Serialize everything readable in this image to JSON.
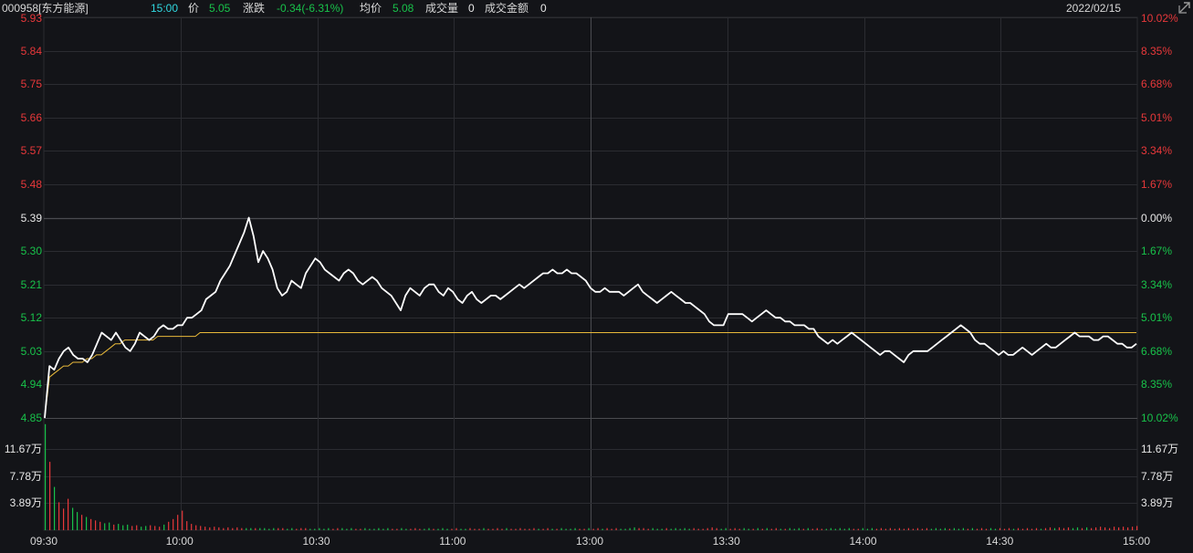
{
  "header": {
    "code_name": "000958[东方能源]",
    "time": "15:00",
    "price_label": "价",
    "price_value": "5.05",
    "change_label": "涨跌",
    "change_value": "-0.34(-6.31%)",
    "avg_label": "均价",
    "avg_value": "5.08",
    "volume_label": "成交量",
    "volume_value": "0",
    "amount_label": "成交金额",
    "amount_value": "0",
    "date": "2022/02/15"
  },
  "icons": {
    "expand": "expand-arrow-icon"
  },
  "colors": {
    "background": "#131418",
    "up": "#e8383a",
    "down": "#18c24a",
    "price_line": "#ffffff",
    "avg_line": "#e8b93a",
    "grid": "#2b2c31",
    "grid_mid": "#4a4b50"
  },
  "price_axis_left": [
    "5.93",
    "5.84",
    "5.75",
    "5.66",
    "5.57",
    "5.48",
    "5.39",
    "5.30",
    "5.21",
    "5.12",
    "5.03",
    "4.94",
    "4.85"
  ],
  "price_axis_right": [
    "10.02%",
    "8.35%",
    "6.68%",
    "5.01%",
    "3.34%",
    "1.67%",
    "0.00%",
    "1.67%",
    "3.34%",
    "5.01%",
    "6.68%",
    "8.35%",
    "10.02%"
  ],
  "volume_axis": [
    "11.67万",
    "7.78万",
    "3.89万"
  ],
  "time_axis": [
    "09:30",
    "10:00",
    "10:30",
    "11:00",
    "13:00",
    "13:30",
    "14:00",
    "14:30",
    "15:00"
  ],
  "chart_data": {
    "type": "line",
    "prev_close": 5.39,
    "ylim": [
      4.85,
      5.93
    ],
    "x_range": [
      "09:30",
      "15:00"
    ],
    "series": [
      {
        "values": [
          4.85,
          4.99,
          4.98,
          5.01,
          5.03,
          5.04,
          5.02,
          5.01,
          5.01,
          5.0,
          5.02,
          5.05,
          5.08,
          5.07,
          5.06,
          5.08,
          5.06,
          5.04,
          5.03,
          5.05,
          5.08,
          5.07,
          5.06,
          5.07,
          5.09,
          5.1,
          5.09,
          5.09,
          5.1,
          5.1,
          5.12,
          5.12,
          5.13,
          5.14,
          5.17,
          5.18,
          5.19,
          5.22,
          5.24,
          5.26,
          5.29,
          5.32,
          5.35,
          5.39,
          5.34,
          5.27,
          5.3,
          5.28,
          5.25,
          5.2,
          5.18,
          5.19,
          5.22,
          5.21,
          5.2,
          5.24,
          5.26,
          5.28,
          5.27,
          5.25,
          5.24,
          5.23,
          5.22,
          5.24,
          5.25,
          5.24,
          5.22,
          5.21,
          5.22,
          5.23,
          5.22,
          5.2,
          5.19,
          5.18,
          5.16,
          5.14,
          5.18,
          5.2,
          5.19,
          5.18,
          5.2,
          5.21,
          5.21,
          5.19,
          5.18,
          5.2,
          5.19,
          5.17,
          5.16,
          5.18,
          5.19,
          5.17,
          5.16,
          5.17,
          5.18,
          5.18,
          5.17,
          5.18,
          5.19,
          5.2,
          5.21,
          5.2,
          5.21,
          5.22,
          5.23,
          5.24,
          5.24,
          5.25,
          5.24,
          5.24,
          5.25,
          5.24,
          5.24,
          5.23,
          5.22,
          5.2,
          5.19,
          5.19,
          5.2,
          5.19,
          5.19,
          5.19,
          5.18,
          5.19,
          5.2,
          5.21,
          5.19,
          5.18,
          5.17,
          5.16,
          5.17,
          5.18,
          5.19,
          5.18,
          5.17,
          5.16,
          5.16,
          5.15,
          5.14,
          5.13,
          5.11,
          5.1,
          5.1,
          5.1,
          5.13,
          5.13,
          5.13,
          5.13,
          5.12,
          5.11,
          5.12,
          5.13,
          5.14,
          5.13,
          5.12,
          5.12,
          5.11,
          5.11,
          5.1,
          5.1,
          5.1,
          5.09,
          5.09,
          5.07,
          5.06,
          5.05,
          5.06,
          5.05,
          5.06,
          5.07,
          5.08,
          5.07,
          5.06,
          5.05,
          5.04,
          5.03,
          5.02,
          5.03,
          5.03,
          5.02,
          5.01,
          5.0,
          5.02,
          5.03,
          5.03,
          5.03,
          5.03,
          5.04,
          5.05,
          5.06,
          5.07,
          5.08,
          5.09,
          5.1,
          5.09,
          5.08,
          5.06,
          5.05,
          5.05,
          5.04,
          5.03,
          5.02,
          5.03,
          5.02,
          5.02,
          5.03,
          5.04,
          5.03,
          5.02,
          5.03,
          5.04,
          5.05,
          5.04,
          5.04,
          5.05,
          5.06,
          5.07,
          5.08,
          5.07,
          5.07,
          5.07,
          5.06,
          5.06,
          5.07,
          5.07,
          5.06,
          5.05,
          5.05,
          5.04,
          5.04,
          5.05
        ],
        "color": "#ffffff"
      },
      {
        "values": [
          4.85,
          4.96,
          4.97,
          4.98,
          4.99,
          4.99,
          5.0,
          5.0,
          5.0,
          5.01,
          5.01,
          5.02,
          5.02,
          5.03,
          5.04,
          5.05,
          5.05,
          5.06,
          5.06,
          5.06,
          5.06,
          5.06,
          5.06,
          5.06,
          5.07,
          5.07,
          5.07,
          5.07,
          5.07,
          5.07,
          5.07,
          5.07,
          5.07,
          5.08,
          5.08,
          5.08,
          5.08,
          5.08,
          5.08,
          5.08,
          5.08,
          5.08,
          5.08,
          5.08,
          5.08,
          5.08,
          5.08,
          5.08,
          5.08,
          5.08,
          5.08,
          5.08,
          5.08,
          5.08,
          5.08,
          5.08,
          5.08,
          5.08,
          5.08,
          5.08,
          5.08,
          5.08,
          5.08,
          5.08,
          5.08,
          5.08,
          5.08,
          5.08,
          5.08,
          5.08,
          5.08,
          5.08,
          5.08,
          5.08,
          5.08,
          5.08,
          5.08,
          5.08,
          5.08,
          5.08,
          5.08,
          5.08,
          5.08,
          5.08,
          5.08,
          5.08,
          5.08,
          5.08,
          5.08,
          5.08,
          5.08,
          5.08,
          5.08,
          5.08,
          5.08,
          5.08,
          5.08,
          5.08,
          5.08,
          5.08,
          5.08,
          5.08,
          5.08,
          5.08,
          5.08,
          5.08,
          5.08,
          5.08,
          5.08,
          5.08,
          5.08,
          5.08,
          5.08,
          5.08,
          5.08,
          5.08,
          5.08,
          5.08,
          5.08,
          5.08,
          5.08,
          5.08,
          5.08,
          5.08,
          5.08,
          5.08,
          5.08,
          5.08,
          5.08,
          5.08,
          5.08,
          5.08,
          5.08,
          5.08,
          5.08,
          5.08,
          5.08,
          5.08,
          5.08,
          5.08,
          5.08,
          5.08,
          5.08,
          5.08,
          5.08,
          5.08,
          5.08,
          5.08,
          5.08,
          5.08,
          5.08,
          5.08,
          5.08,
          5.08,
          5.08,
          5.08,
          5.08,
          5.08,
          5.08,
          5.08,
          5.08,
          5.08,
          5.08,
          5.08,
          5.08,
          5.08,
          5.08,
          5.08,
          5.08,
          5.08,
          5.08,
          5.08,
          5.08,
          5.08,
          5.08,
          5.08,
          5.08,
          5.08,
          5.08,
          5.08,
          5.08,
          5.08,
          5.08,
          5.08,
          5.08,
          5.08,
          5.08,
          5.08,
          5.08,
          5.08,
          5.08,
          5.08,
          5.08,
          5.08,
          5.08,
          5.08,
          5.08,
          5.08,
          5.08,
          5.08,
          5.08,
          5.08,
          5.08,
          5.08,
          5.08,
          5.08,
          5.08,
          5.08,
          5.08,
          5.08,
          5.08,
          5.08,
          5.08,
          5.08,
          5.08,
          5.08,
          5.08,
          5.08,
          5.08,
          5.08,
          5.08,
          5.08,
          5.08,
          5.08,
          5.08,
          5.08,
          5.08,
          5.08,
          5.08,
          5.08,
          5.08,
          5.08,
          5.08
        ],
        "color": "#e8b93a"
      }
    ],
    "volume_ylim": [
      0,
      15.56
    ],
    "volume_unit": "万",
    "volume": [
      15.2,
      9.8,
      6.2,
      4.0,
      3.1,
      4.5,
      3.2,
      2.6,
      2.2,
      1.9,
      1.6,
      1.4,
      1.2,
      1.0,
      1.1,
      0.8,
      0.9,
      0.7,
      0.8,
      0.6,
      0.7,
      0.5,
      0.6,
      0.7,
      0.6,
      0.5,
      0.8,
      1.2,
      1.6,
      2.2,
      2.8,
      1.3,
      0.9,
      0.7,
      0.6,
      0.5,
      0.4,
      0.5,
      0.4,
      0.3,
      0.4,
      0.3,
      0.4,
      0.3,
      0.3,
      0.3,
      0.3,
      0.3,
      0.3,
      0.2,
      0.3,
      0.3,
      0.3,
      0.2,
      0.3,
      0.2,
      0.3,
      0.3,
      0.2,
      0.2,
      0.3,
      0.2,
      0.3,
      0.2,
      0.3,
      0.3,
      0.2,
      0.3,
      0.2,
      0.2,
      0.3,
      0.2,
      0.2,
      0.3,
      0.2,
      0.3,
      0.2,
      0.2,
      0.3,
      0.2,
      0.2,
      0.3,
      0.2,
      0.2,
      0.3,
      0.2,
      0.2,
      0.3,
      0.2,
      0.2,
      0.3,
      0.2,
      0.2,
      0.3,
      0.2,
      0.2,
      0.3,
      0.2,
      0.2,
      0.3,
      0.2,
      0.3,
      0.2,
      0.2,
      0.3,
      0.2,
      0.2,
      0.3,
      0.2,
      0.2,
      0.3,
      0.2,
      0.2,
      0.3,
      0.2,
      0.2,
      0.3,
      0.2,
      0.2,
      0.3,
      0.2,
      0.3,
      0.2,
      0.3,
      0.2,
      0.3,
      0.2,
      0.2,
      0.3,
      0.4,
      0.3,
      0.3,
      0.2,
      0.3,
      0.2,
      0.2,
      0.3,
      0.2,
      0.3,
      0.2,
      0.3,
      0.2,
      0.3,
      0.2,
      0.2,
      0.3,
      0.4,
      0.3,
      0.2,
      0.3,
      0.2,
      0.3,
      0.2,
      0.3,
      0.2,
      0.2,
      0.3,
      0.2,
      0.3,
      0.2,
      0.3,
      0.2,
      0.2,
      0.3,
      0.2,
      0.3,
      0.2,
      0.3,
      0.2,
      0.3,
      0.2,
      0.2,
      0.3,
      0.2,
      0.3,
      0.2,
      0.3,
      0.2,
      0.2,
      0.3,
      0.2,
      0.3,
      0.2,
      0.3,
      0.2,
      0.3,
      0.2,
      0.3,
      0.2,
      0.3,
      0.2,
      0.3,
      0.2,
      0.3,
      0.2,
      0.3,
      0.2,
      0.3,
      0.2,
      0.3,
      0.2,
      0.3,
      0.2,
      0.3,
      0.2,
      0.3,
      0.2,
      0.3,
      0.2,
      0.3,
      0.2,
      0.3,
      0.2,
      0.3,
      0.2,
      0.3,
      0.2,
      0.3,
      0.2,
      0.3,
      0.4,
      0.3,
      0.4,
      0.3,
      0.4,
      0.3,
      0.4,
      0.3,
      0.4,
      0.3,
      0.4,
      0.5,
      0.4,
      0.3,
      0.5,
      0.4,
      0.5,
      0.4,
      0.5,
      0.6
    ]
  }
}
